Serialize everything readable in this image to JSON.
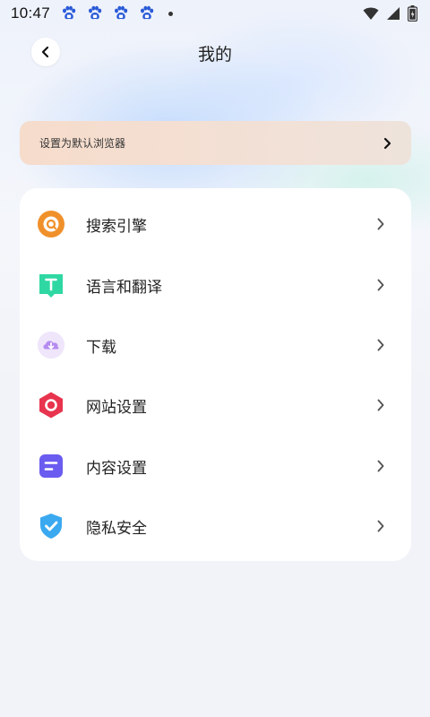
{
  "status_bar": {
    "time": "10:47",
    "notification_icons": [
      "baidu-paw-icon",
      "baidu-paw-icon",
      "baidu-paw-icon",
      "baidu-paw-icon"
    ]
  },
  "header": {
    "title": "我的",
    "back_icon": "chevron-left-icon"
  },
  "default_browser_banner": {
    "label": "设置为默认浏览器",
    "icon": "chevron-right-icon"
  },
  "settings_menu": {
    "items": [
      {
        "label": "搜索引擎",
        "icon": "search-engine-icon",
        "color": "#f0902a"
      },
      {
        "label": "语言和翻译",
        "icon": "translate-icon",
        "color": "#2fd8a2"
      },
      {
        "label": "下载",
        "icon": "download-cloud-icon",
        "color": "#b58bf0"
      },
      {
        "label": "网站设置",
        "icon": "website-settings-icon",
        "color": "#e8344e"
      },
      {
        "label": "内容设置",
        "icon": "content-settings-icon",
        "color": "#6a5cf0"
      },
      {
        "label": "隐私安全",
        "icon": "privacy-shield-icon",
        "color": "#3aa9f0"
      }
    ]
  },
  "colors": {
    "background": "#f2f3f8",
    "card": "#ffffff",
    "banner_start": "#f6dccb",
    "chevron": "#555555"
  }
}
